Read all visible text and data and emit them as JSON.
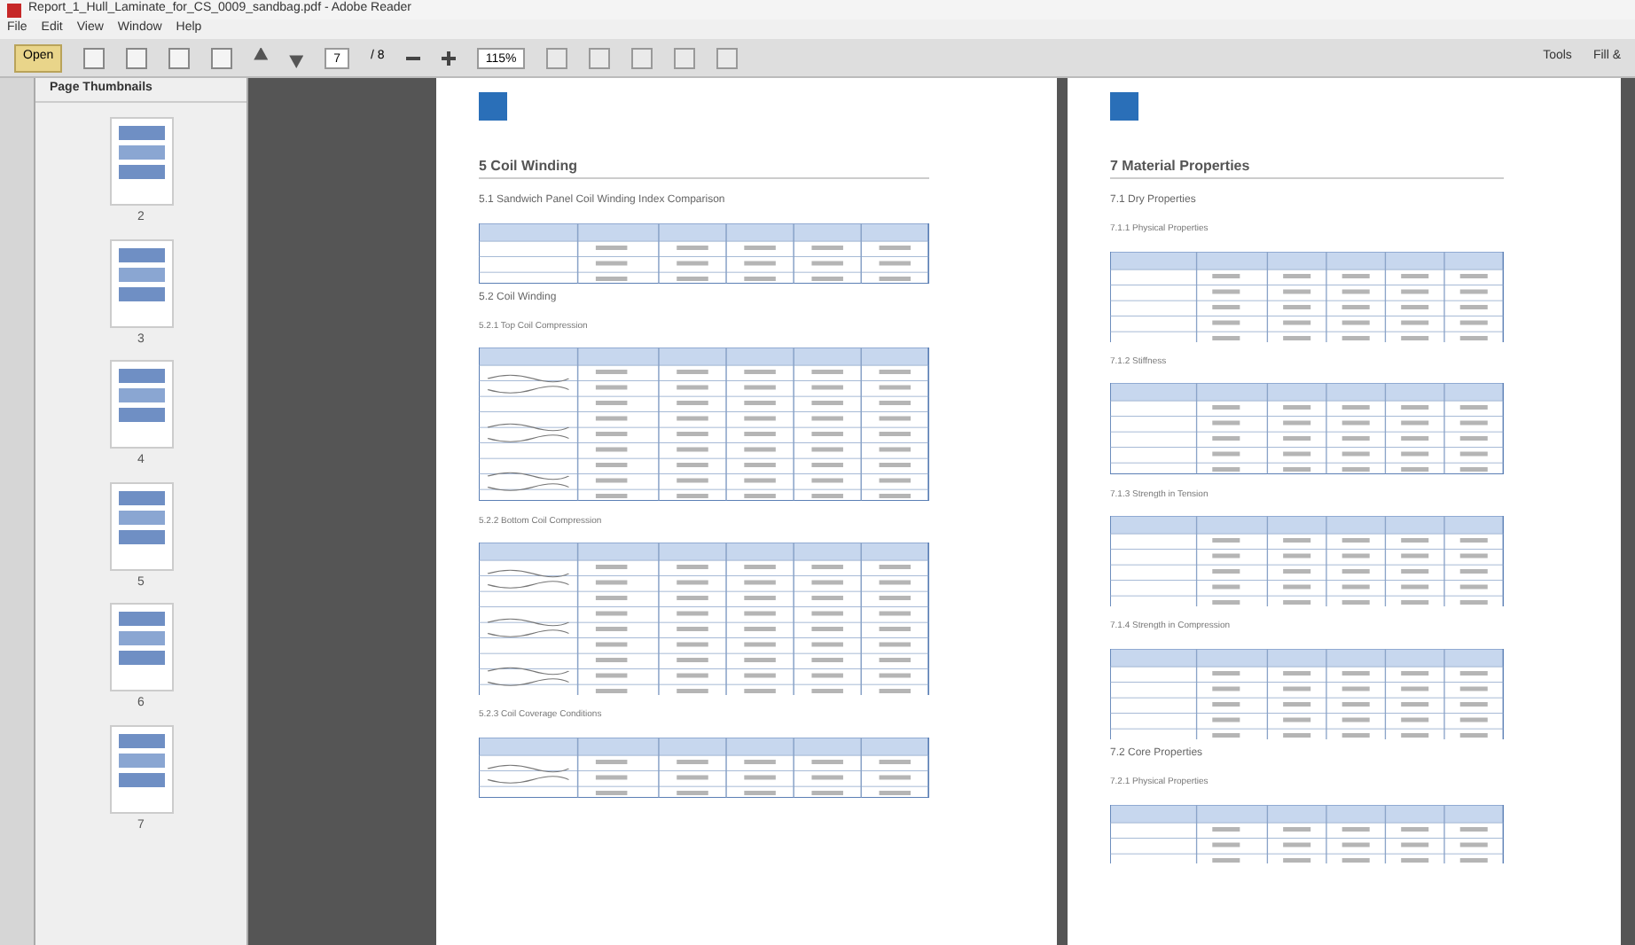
{
  "window": {
    "title": "Report_1_Hull_Laminate_for_CS_0009_sandbag.pdf - Adobe Reader"
  },
  "menu": [
    "File",
    "Edit",
    "View",
    "Window",
    "Help"
  ],
  "toolbar": {
    "open": "Open",
    "page_current": "7",
    "page_total": "/ 8",
    "zoom": "115%",
    "tools": "Tools",
    "fill_sign": "Fill &"
  },
  "sidebar": {
    "title": "Page Thumbnails",
    "thumbnails": [
      {
        "label": "2"
      },
      {
        "label": "3"
      },
      {
        "label": "4"
      },
      {
        "label": "5"
      },
      {
        "label": "6"
      },
      {
        "label": "7"
      }
    ]
  },
  "pages": [
    {
      "blocks": [
        {
          "kind": "h1",
          "text": "5 Coil Winding"
        },
        {
          "kind": "h2",
          "text": "5.1 Sandwich Panel Coil Winding Index Comparison"
        },
        {
          "kind": "smalldatatable"
        },
        {
          "kind": "h2",
          "text": "5.2 Coil Winding"
        },
        {
          "kind": "h3",
          "text": "5.2.1 Top Coil Compression"
        },
        {
          "kind": "coiltable"
        },
        {
          "kind": "h3",
          "text": "5.2.2 Bottom Coil Compression"
        },
        {
          "kind": "coiltable"
        },
        {
          "kind": "h3",
          "text": "5.2.3 Coil Coverage Conditions"
        },
        {
          "kind": "smallcoiltable"
        }
      ]
    },
    {
      "blocks": [
        {
          "kind": "h1",
          "text": "7 Material Properties"
        },
        {
          "kind": "h2",
          "text": "7.1 Dry Properties"
        },
        {
          "kind": "h3",
          "text": "7.1.1 Physical Properties"
        },
        {
          "kind": "datatable"
        },
        {
          "kind": "h3",
          "text": "7.1.2 Stiffness"
        },
        {
          "kind": "datatable"
        },
        {
          "kind": "h3",
          "text": "7.1.3 Strength in Tension"
        },
        {
          "kind": "datatable"
        },
        {
          "kind": "h3",
          "text": "7.1.4 Strength in Compression"
        },
        {
          "kind": "datatable"
        },
        {
          "kind": "h2",
          "text": "7.2 Core Properties"
        },
        {
          "kind": "h3",
          "text": "7.2.1 Physical Properties"
        },
        {
          "kind": "smalldatatable"
        }
      ]
    }
  ]
}
